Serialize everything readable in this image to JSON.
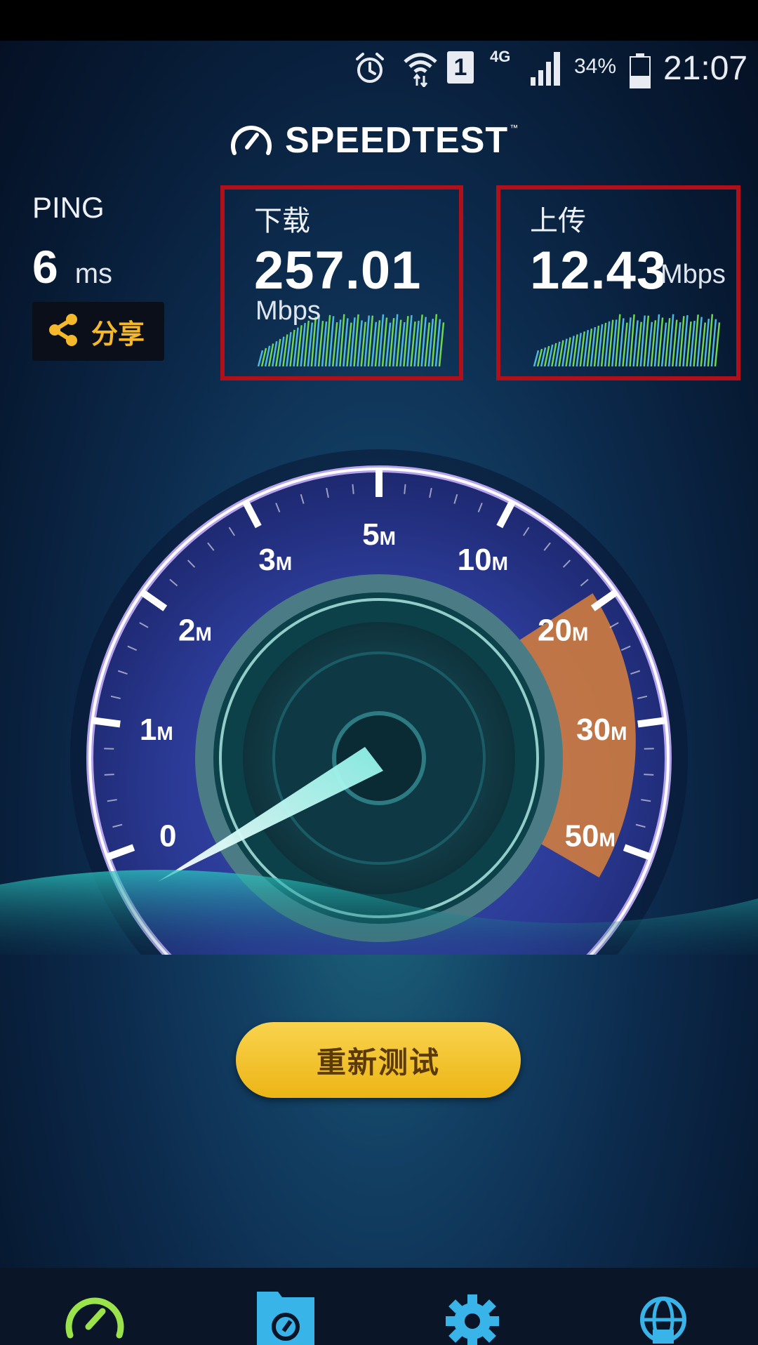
{
  "status_bar": {
    "alarm_icon": "alarm-clock-icon",
    "wifi_icon": "wifi-icon",
    "sim_label": "1",
    "network_type": "4G",
    "signal_icon": "signal-bars-icon",
    "battery_percent": "34%",
    "battery_icon": "battery-icon",
    "time": "21:07"
  },
  "header": {
    "logo_icon": "speedometer-icon",
    "title": "SPEEDTEST",
    "trademark": "™"
  },
  "ping": {
    "label": "PING",
    "value": "6",
    "unit": "ms"
  },
  "share": {
    "icon": "share-icon",
    "label": "分享"
  },
  "download": {
    "label": "下载",
    "value": "257.01",
    "unit": "Mbps"
  },
  "upload": {
    "label": "上传",
    "value": "12.43",
    "unit": "Mbps"
  },
  "gauge": {
    "scale": [
      {
        "big": "0",
        "small": ""
      },
      {
        "big": "1",
        "small": "M"
      },
      {
        "big": "2",
        "small": "M"
      },
      {
        "big": "3",
        "small": "M"
      },
      {
        "big": "5",
        "small": "M"
      },
      {
        "big": "10",
        "small": "M"
      },
      {
        "big": "20",
        "small": "M"
      },
      {
        "big": "30",
        "small": "M"
      },
      {
        "big": "50",
        "small": "M"
      }
    ]
  },
  "retest_button": {
    "label": "重新测试"
  },
  "bottom_nav": [
    {
      "name": "speed",
      "icon": "speedometer-icon",
      "color": "#9be34a"
    },
    {
      "name": "results",
      "icon": "results-folder-icon",
      "color": "#38b4e8"
    },
    {
      "name": "settings",
      "icon": "gear-icon",
      "color": "#38b4e8"
    },
    {
      "name": "global",
      "icon": "globe-lock-icon",
      "color": "#38b4e8"
    }
  ],
  "colors": {
    "highlight_box": "#b0101a",
    "accent_yellow": "#f5b82a",
    "gauge_orange": "#d9803a"
  }
}
